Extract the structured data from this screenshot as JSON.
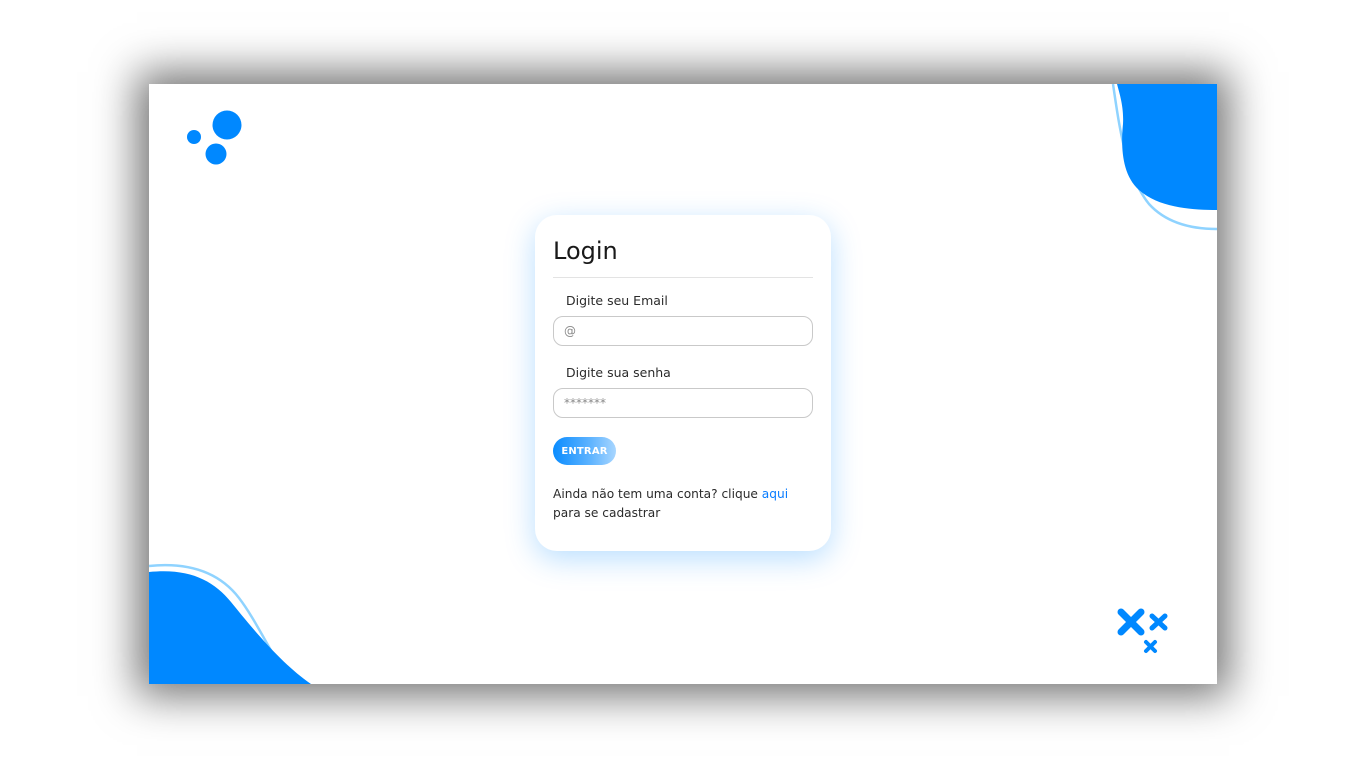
{
  "login": {
    "title": "Login",
    "email_label": "Digite seu Email",
    "email_placeholder": "@",
    "email_value": "",
    "password_label": "Digite sua senha",
    "password_placeholder": "*******",
    "password_value": "",
    "submit_label": "ENTRAR",
    "signup_prefix": "Ainda não tem uma conta? clique",
    "signup_link": "aqui",
    "signup_suffix": "para se cadastrar"
  },
  "decorations": {
    "top_left": "dots-icon",
    "top_right": "blob-shape",
    "bottom_left": "blob-shape",
    "bottom_right": "crosses-icon"
  },
  "colors": {
    "accent": "#0088ff",
    "accent_light": "#8fd3ff",
    "link": "#0a7dff",
    "card_shadow": "#cfe6ff"
  }
}
